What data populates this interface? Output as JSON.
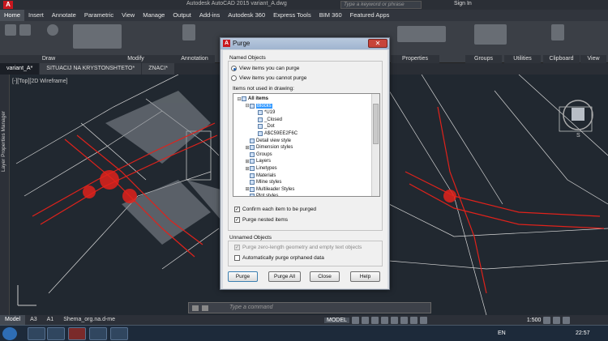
{
  "titlebar": {
    "title": "Autodesk AutoCAD 2015    variant_A.dwg",
    "search_placeholder": "Type a keyword or phrase",
    "signin": "Sign In"
  },
  "ribbon_tabs": [
    "Home",
    "Insert",
    "Annotate",
    "Parametric",
    "View",
    "Manage",
    "Output",
    "Add-ins",
    "Autodesk 360",
    "Express Tools",
    "BIM 360",
    "Featured Apps"
  ],
  "ribbon_panels": [
    "Draw",
    "Modify",
    "Annotation",
    "Properties",
    "Groups",
    "Utilities",
    "Clipboard",
    "View"
  ],
  "doc_tabs": [
    "variant_A*",
    "SITUACIJ NA KRYSTONSHTETO*",
    "ZNACI*"
  ],
  "viewport": {
    "view_label": "[-][Top][2D Wireframe]",
    "side_palette": "Layer Properties Manager",
    "compass": "S"
  },
  "cmdline": {
    "placeholder": "Type a command"
  },
  "layout_tabs": [
    "Model",
    "A3",
    "A1",
    "Shema_org.na.d-me"
  ],
  "status": {
    "model": "MODEL",
    "scale": "1:500"
  },
  "taskbar": {
    "lang": "EN",
    "clock": "22:57"
  },
  "dialog": {
    "title": "Purge",
    "named_objects": "Named Objects",
    "radio_can": "View items you can purge",
    "radio_cannot": "View items you cannot purge",
    "items_label": "Items not used in drawing:",
    "tree": [
      {
        "label": "All items",
        "level": 0,
        "exp": "⊟",
        "bold": true
      },
      {
        "label": "Blocks",
        "level": 1,
        "exp": "⊟",
        "sel": true
      },
      {
        "label": "*U19",
        "level": 2
      },
      {
        "label": "_Closed",
        "level": 2
      },
      {
        "label": "_Dot",
        "level": 2
      },
      {
        "label": "A$C59EE2F6C",
        "level": 2
      },
      {
        "label": "Detail view style",
        "level": 1
      },
      {
        "label": "Dimension styles",
        "level": 1,
        "exp": "⊞"
      },
      {
        "label": "Groups",
        "level": 1
      },
      {
        "label": "Layers",
        "level": 1,
        "exp": "⊞"
      },
      {
        "label": "Linetypes",
        "level": 1,
        "exp": "⊞"
      },
      {
        "label": "Materials",
        "level": 1
      },
      {
        "label": "Mline styles",
        "level": 1
      },
      {
        "label": "Multileader Styles",
        "level": 1,
        "exp": "⊞"
      },
      {
        "label": "Plot styles",
        "level": 1
      }
    ],
    "confirm": "Confirm each item to be purged",
    "nested": "Purge nested items",
    "unnamed_objects": "Unnamed Objects",
    "zero_length": "Purge zero-length geometry and empty text objects",
    "orphaned": "Automatically purge orphaned data",
    "buttons": [
      "Purge",
      "Purge All",
      "Close",
      "Help"
    ]
  }
}
